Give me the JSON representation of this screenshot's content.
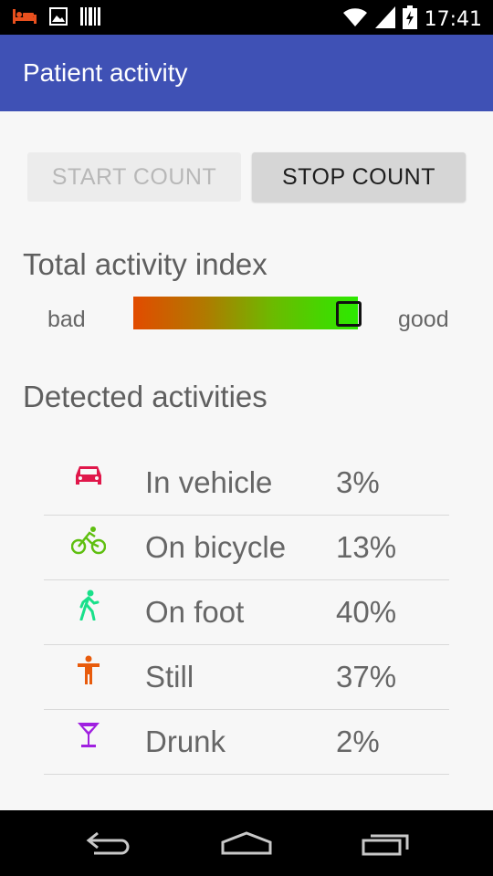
{
  "status_bar": {
    "time": "17:41",
    "left_icons": [
      "bed-icon",
      "image-icon",
      "barcode-icon"
    ],
    "right_icons": [
      "wifi-icon",
      "signal-icon",
      "battery-icon"
    ]
  },
  "app_bar": {
    "title": "Patient activity"
  },
  "buttons": {
    "start_label": "START COUNT",
    "stop_label": "STOP COUNT",
    "start_enabled": false
  },
  "total_activity": {
    "title": "Total activity index",
    "low_label": "bad",
    "high_label": "good",
    "level": 0.96,
    "gradient_colors": [
      "#e24b00",
      "#2bea00"
    ]
  },
  "detected": {
    "title": "Detected activities",
    "items": [
      {
        "icon": "car-icon",
        "color": "#e0174a",
        "label": "In vehicle",
        "value": "3%"
      },
      {
        "icon": "bicycle-icon",
        "color": "#5fbf10",
        "label": "On bicycle",
        "value": "13%"
      },
      {
        "icon": "walking-icon",
        "color": "#19e08a",
        "label": "On foot",
        "value": "40%"
      },
      {
        "icon": "standing-person-icon",
        "color": "#e85b0c",
        "label": "Still",
        "value": "37%"
      },
      {
        "icon": "cocktail-icon",
        "color": "#a020e0",
        "label": "Drunk",
        "value": "2%"
      }
    ]
  },
  "nav_bar": {
    "icons": [
      "back-icon",
      "home-icon",
      "recents-icon"
    ]
  },
  "colors": {
    "app_bar": "#3f51b5",
    "background": "#f7f7f7"
  }
}
